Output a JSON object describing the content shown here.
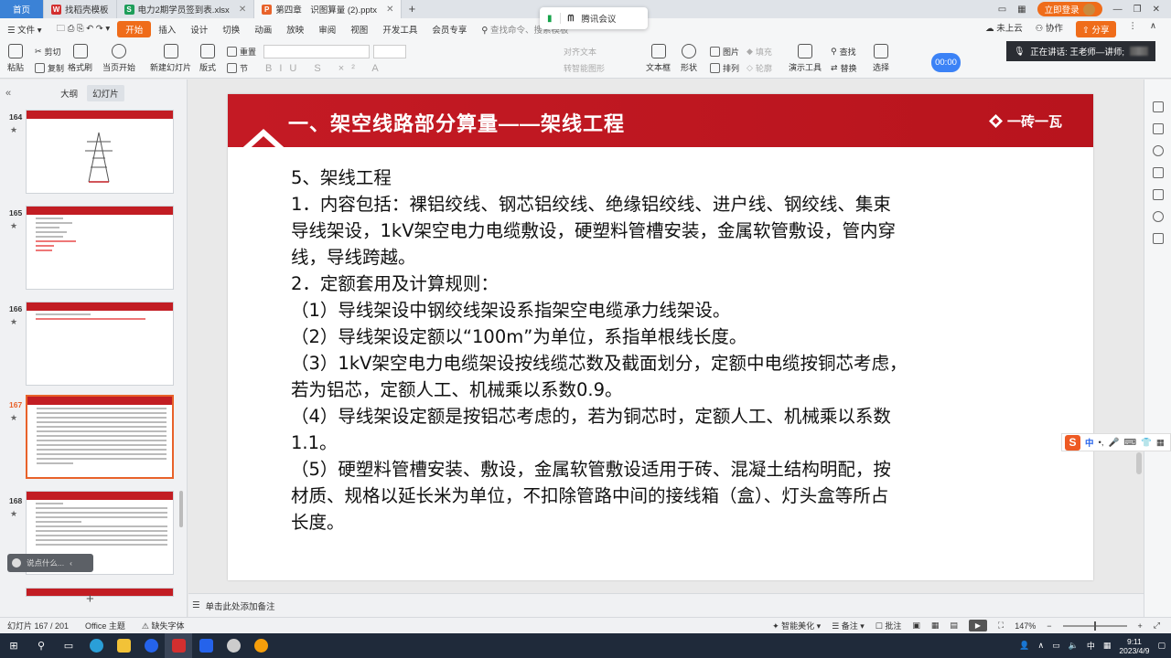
{
  "tabs": {
    "home": "首页",
    "items": [
      {
        "label": "找稻壳模板",
        "icon": "wps-icon",
        "color": "#d32f2f",
        "glyph": "W"
      },
      {
        "label": "电力2期学员签到表.xlsx",
        "icon": "spreadsheet-icon",
        "color": "#1e9e5a",
        "glyph": "S"
      },
      {
        "label": "第四章　识图算量 (2).pptx",
        "icon": "presentation-icon",
        "color": "#e8622a",
        "glyph": "P"
      }
    ]
  },
  "meeting": {
    "label": "腾讯会议"
  },
  "login": {
    "label": "立即登录"
  },
  "menu": {
    "items": [
      "文件",
      "开始",
      "插入",
      "设计",
      "切换",
      "动画",
      "放映",
      "审阅",
      "视图",
      "开发工具",
      "会员专享"
    ],
    "search": "查找命令、搜索模板",
    "cloud": "未上云",
    "collab": "协作",
    "share": "分享"
  },
  "ribbon": {
    "paste": "粘贴",
    "cut": "剪切",
    "copy": "复制",
    "format_painter": "格式刷",
    "play_from": "当页开始",
    "new_slide": "新建幻灯片",
    "layout": "版式",
    "reset": "重置",
    "section": "节",
    "text_box": "文本框",
    "shape": "形状",
    "picture": "图片",
    "arrange": "排列",
    "fill": "填充",
    "outline": "轮廓",
    "present_tool": "演示工具",
    "find": "查找",
    "replace": "替换",
    "select": "选择",
    "align_text": "对齐文本",
    "convert_graphic": "转智能图形",
    "timer": "00:00",
    "speaking": "正在讲话: 王老师—讲师;"
  },
  "left_panel": {
    "tab_outline": "大纲",
    "tab_slides": "幻灯片",
    "slides": [
      {
        "num": "164"
      },
      {
        "num": "165"
      },
      {
        "num": "166"
      },
      {
        "num": "167"
      },
      {
        "num": "168"
      }
    ],
    "floating_input": "说点什么..."
  },
  "slide": {
    "title": "一、架空线路部分算量——架线工程",
    "logo": "一砖一瓦",
    "lines": [
      "5、架线工程",
      "1．内容包括：裸铝绞线、钢芯铝绞线、绝缘铝绞线、进户线、钢绞线、集束",
      "导线架设，1kV架空电力电缆敷设，硬塑料管槽安装，金属软管敷设，管内穿",
      "线，导线跨越。",
      "2．定额套用及计算规则：",
      "（1）导线架设中钢绞线架设系指架空电缆承力线架设。",
      "（2）导线架设定额以“100m”为单位，系指单根线长度。",
      "（3）1kV架空电力电缆架设按线缆芯数及截面划分，定额中电缆按铜芯考虑，",
      "若为铝芯，定额人工、机械乘以系数0.9。",
      "（4）导线架设定额是按铝芯考虑的，若为铜芯时，定额人工、机械乘以系数",
      "1.1。",
      "（5）硬塑料管槽安装、敷设，金属软管敷设适用于砖、混凝土结构明配，按",
      "材质、规格以延长米为单位，不扣除管路中间的接线箱（盒）、灯头盒等所占",
      "长度。"
    ]
  },
  "notes": {
    "placeholder": "单击此处添加备注"
  },
  "ime": {
    "s": "S",
    "lang": "中"
  },
  "status": {
    "slide_count": "幻灯片 167 / 201",
    "theme": "Office 主题",
    "missing_font": "缺失字体",
    "smart_beautify": "智能美化",
    "notes": "备注",
    "comments": "批注",
    "zoom": "147%"
  },
  "taskbar": {
    "time": "9:11",
    "date": "2023/4/9",
    "lang": "中"
  },
  "colors": {
    "accent": "#ef6c1a",
    "slide_banner": "#c41a24",
    "selected_thumb": "#e8622a"
  }
}
